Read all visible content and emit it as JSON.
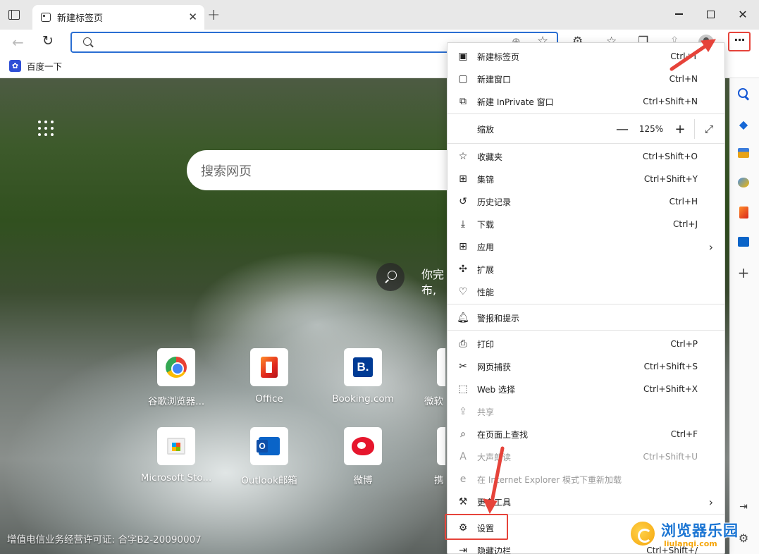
{
  "browser": {
    "tab": {
      "title": "新建标签页",
      "close_glyph": "✕"
    },
    "newtab_glyph": "+",
    "window": {
      "close_glyph": "✕"
    }
  },
  "toolbar": {
    "back_glyph": "←",
    "refresh_glyph": "↻",
    "address_value": "",
    "more_glyph": "···"
  },
  "favorites_bar": {
    "items": [
      {
        "label": "百度一下",
        "icon": "baidu-paw-icon"
      }
    ]
  },
  "ntp": {
    "search_placeholder": "搜索网页",
    "bg_caption": "你完布,",
    "quick_links": [
      {
        "label": "谷歌浏览器...",
        "icon": "chrome-icon"
      },
      {
        "label": "Office",
        "icon": "office-icon"
      },
      {
        "label": "Booking.com",
        "icon": "booking-icon"
      },
      {
        "label": "微软",
        "icon": "partial-icon"
      },
      {
        "label": "Microsoft Sto...",
        "icon": "store-icon"
      },
      {
        "label": "Outlook邮箱",
        "icon": "outlook-icon"
      },
      {
        "label": "微博",
        "icon": "weibo-icon"
      },
      {
        "label": "携",
        "icon": "partial-icon"
      }
    ],
    "booking_letter": "B.",
    "license": "增值电信业务经营许可证: 合字B2-20090007"
  },
  "menu": {
    "items": [
      {
        "key": "new_tab",
        "label": "新建标签页",
        "shortcut": "Ctrl+T",
        "icon": "new-tab-icon"
      },
      {
        "key": "new_window",
        "label": "新建窗口",
        "shortcut": "Ctrl+N",
        "icon": "new-window-icon"
      },
      {
        "key": "inprivate",
        "label": "新建 InPrivate 窗口",
        "shortcut": "Ctrl+Shift+N",
        "icon": "inprivate-icon"
      },
      {
        "key": "zoom",
        "label": "缩放",
        "value": "125%"
      },
      {
        "key": "favorites",
        "label": "收藏夹",
        "shortcut": "Ctrl+Shift+O",
        "icon": "favorites-icon"
      },
      {
        "key": "collections",
        "label": "集锦",
        "shortcut": "Ctrl+Shift+Y",
        "icon": "collections-icon"
      },
      {
        "key": "history",
        "label": "历史记录",
        "shortcut": "Ctrl+H",
        "icon": "history-icon"
      },
      {
        "key": "downloads",
        "label": "下载",
        "shortcut": "Ctrl+J",
        "icon": "download-icon"
      },
      {
        "key": "apps",
        "label": "应用",
        "icon": "apps-icon"
      },
      {
        "key": "extensions",
        "label": "扩展",
        "icon": "extensions-icon"
      },
      {
        "key": "performance",
        "label": "性能",
        "icon": "performance-icon"
      },
      {
        "key": "alerts",
        "label": "警报和提示",
        "icon": "bell-icon"
      },
      {
        "key": "print",
        "label": "打印",
        "shortcut": "Ctrl+P",
        "icon": "print-icon"
      },
      {
        "key": "web_capture",
        "label": "网页捕获",
        "shortcut": "Ctrl+Shift+S",
        "icon": "web-capture-icon"
      },
      {
        "key": "web_select",
        "label": "Web 选择",
        "shortcut": "Ctrl+Shift+X",
        "icon": "web-select-icon"
      },
      {
        "key": "share",
        "label": "共享",
        "icon": "share-icon"
      },
      {
        "key": "find",
        "label": "在页面上查找",
        "shortcut": "Ctrl+F",
        "icon": "find-icon"
      },
      {
        "key": "read_aloud",
        "label": "大声朗读",
        "shortcut": "Ctrl+Shift+U",
        "icon": "read-aloud-icon"
      },
      {
        "key": "ie_mode",
        "label": "在 Internet Explorer 模式下重新加载",
        "icon": "ie-icon"
      },
      {
        "key": "more_tools",
        "label": "更多工具",
        "icon": "more-tools-icon"
      },
      {
        "key": "settings",
        "label": "设置",
        "icon": "gear-icon"
      },
      {
        "key": "hide_sidebar",
        "label": "隐藏边栏",
        "shortcut": "Ctrl+Shift+/",
        "icon": "sidebar-icon"
      }
    ],
    "zoom_minus": "—",
    "zoom_plus": "+",
    "chevron": "›"
  },
  "sidebar": {
    "add_glyph": "+"
  },
  "watermark": {
    "title": "浏览器乐园",
    "url": "liulanqi.com"
  },
  "colors": {
    "accent": "#2a6ed2",
    "annotation": "#e6433a"
  }
}
